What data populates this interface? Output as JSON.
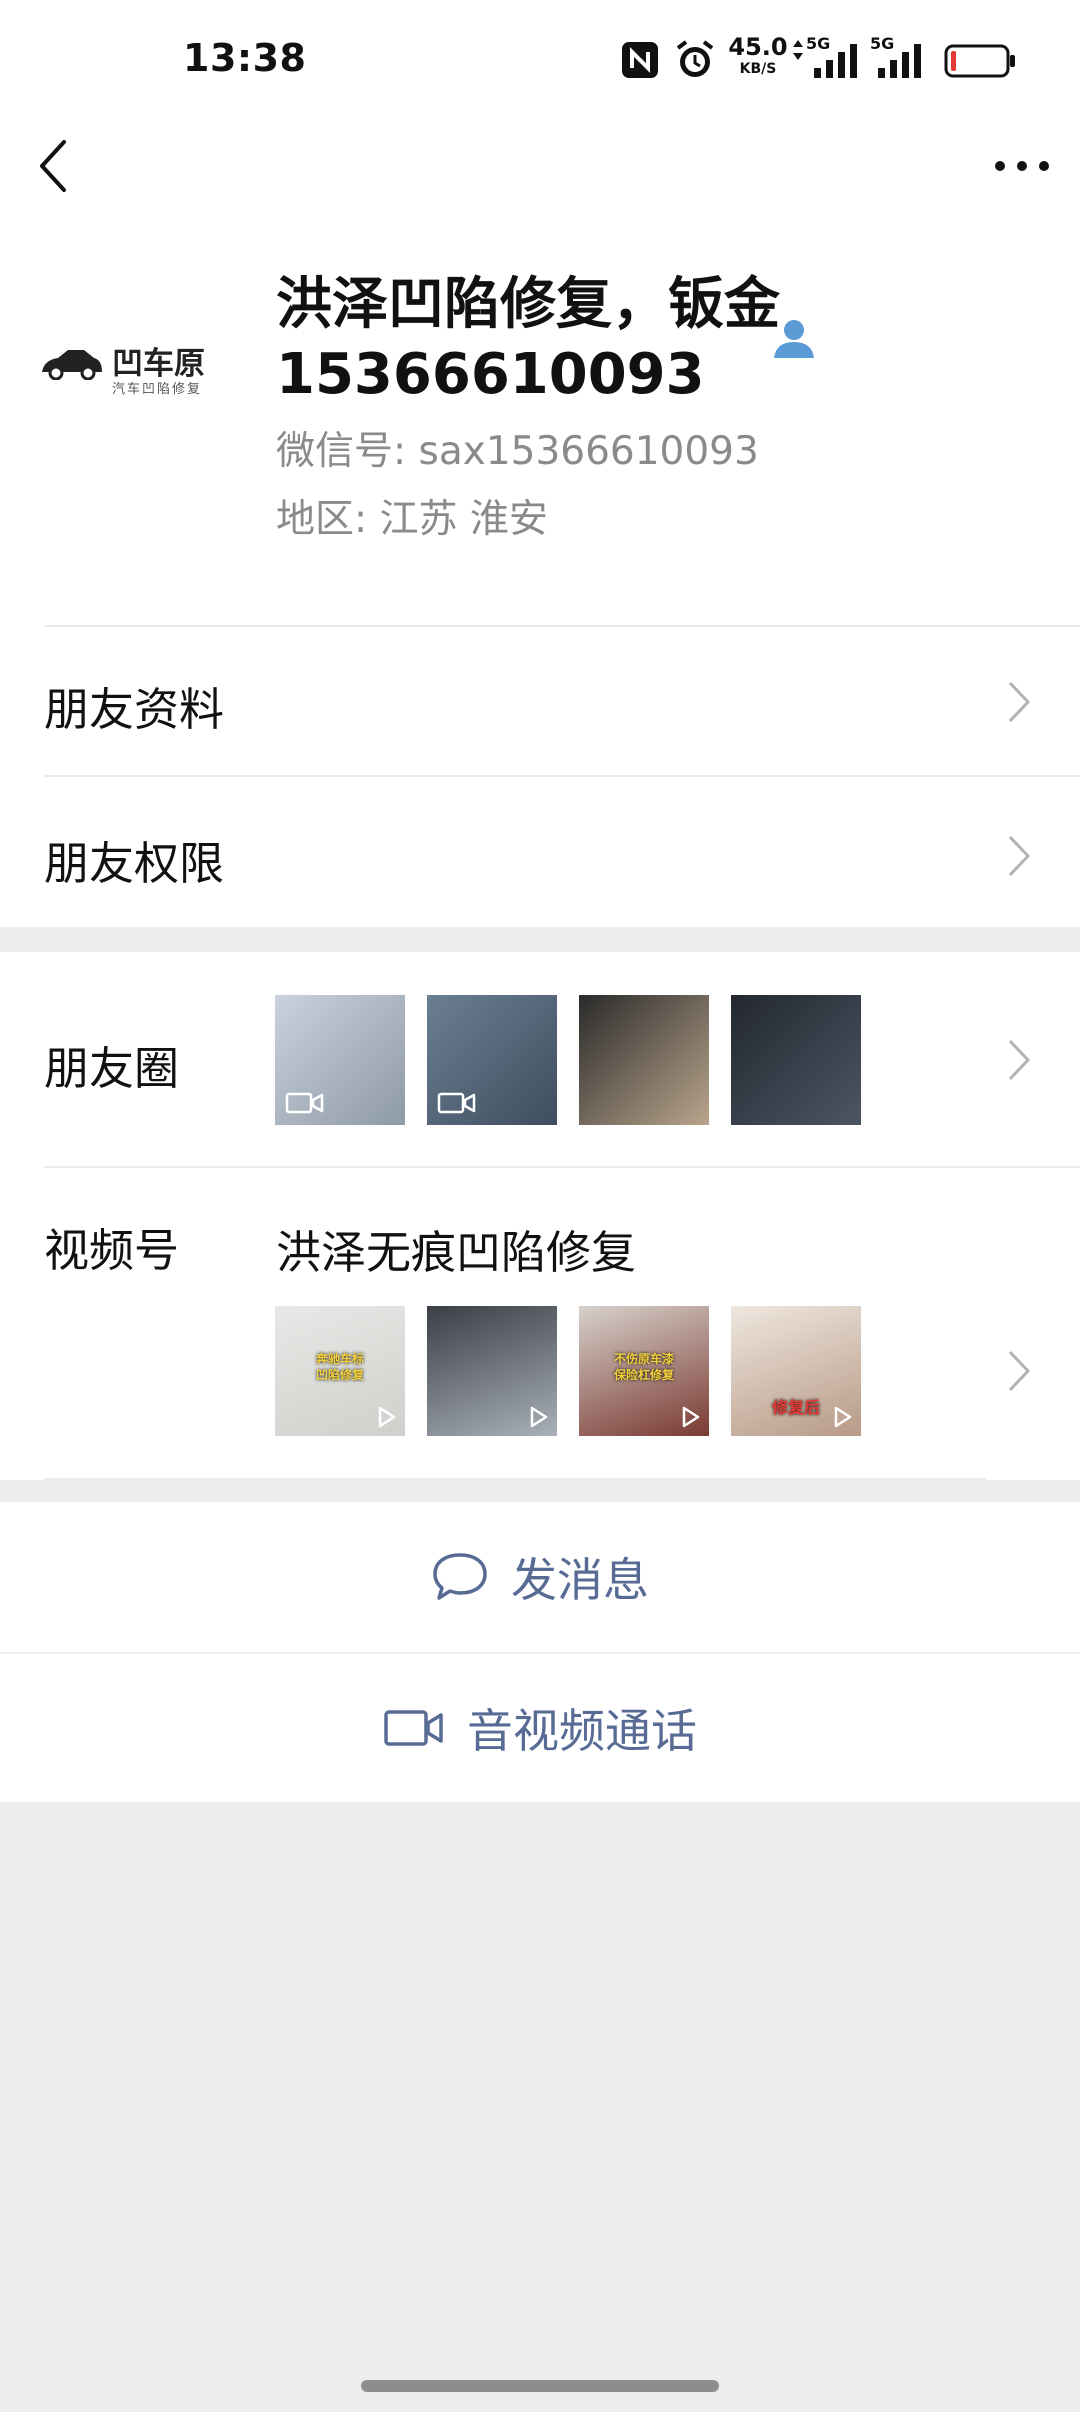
{
  "status_bar": {
    "time": "13:38",
    "net_speed": "45.0",
    "net_unit": "KB/S",
    "signal1_label": "5G",
    "signal2_label": "5G",
    "icons": [
      "nfc-icon",
      "alarm-icon",
      "data-arrows-icon",
      "signal-icon",
      "signal-icon",
      "battery-icon"
    ]
  },
  "nav": {
    "back_icon": "chevron-left-icon",
    "more_icon": "more-dots-icon"
  },
  "profile": {
    "avatar_text": "凹车原",
    "avatar_subtext": "汽车凹陷修复",
    "name_line1": "洪泽凹陷修复，钣金",
    "name_line2": "15366610093",
    "wechat_id": "微信号:  sax15366610093",
    "region": "地区:  江苏  淮安",
    "badge_icon": "person-icon"
  },
  "rows": {
    "friend_info": "朋友资料",
    "friend_permissions": "朋友权限",
    "moments": "朋友圈",
    "channels": "视频号",
    "channels_title": "洪泽无痕凹陷修复"
  },
  "moments_thumbs": [
    {
      "icon": "video-icon",
      "colors": [
        "#c9d2dd",
        "#8e9aa6"
      ]
    },
    {
      "icon": "video-icon",
      "colors": [
        "#6b7f92",
        "#3e4e5e"
      ]
    },
    {
      "icon": "",
      "colors": [
        "#2a2a2a",
        "#b9a58c"
      ]
    },
    {
      "icon": "",
      "colors": [
        "#23282f",
        "#4b5564"
      ]
    }
  ],
  "channel_thumbs": [
    {
      "caption": "奔驰车标",
      "caption2": "凹陷修复",
      "colors": [
        "#e8e8e6",
        "#cfcfcc"
      ]
    },
    {
      "caption": "",
      "caption2": "",
      "colors": [
        "#3b3f45",
        "#a9b0b8"
      ]
    },
    {
      "caption": "不伤原车漆",
      "caption2": "保险杠修复",
      "colors": [
        "#d7d1cb",
        "#7a3a32"
      ]
    },
    {
      "caption": "修复后",
      "caption2": "",
      "colors": [
        "#efe7df",
        "#b79a86"
      ]
    }
  ],
  "actions": {
    "message": "发消息",
    "call": "音视频通话",
    "message_icon": "chat-bubble-icon",
    "call_icon": "video-camera-icon"
  },
  "colors": {
    "link": "#576b95",
    "background": "#ededed"
  }
}
